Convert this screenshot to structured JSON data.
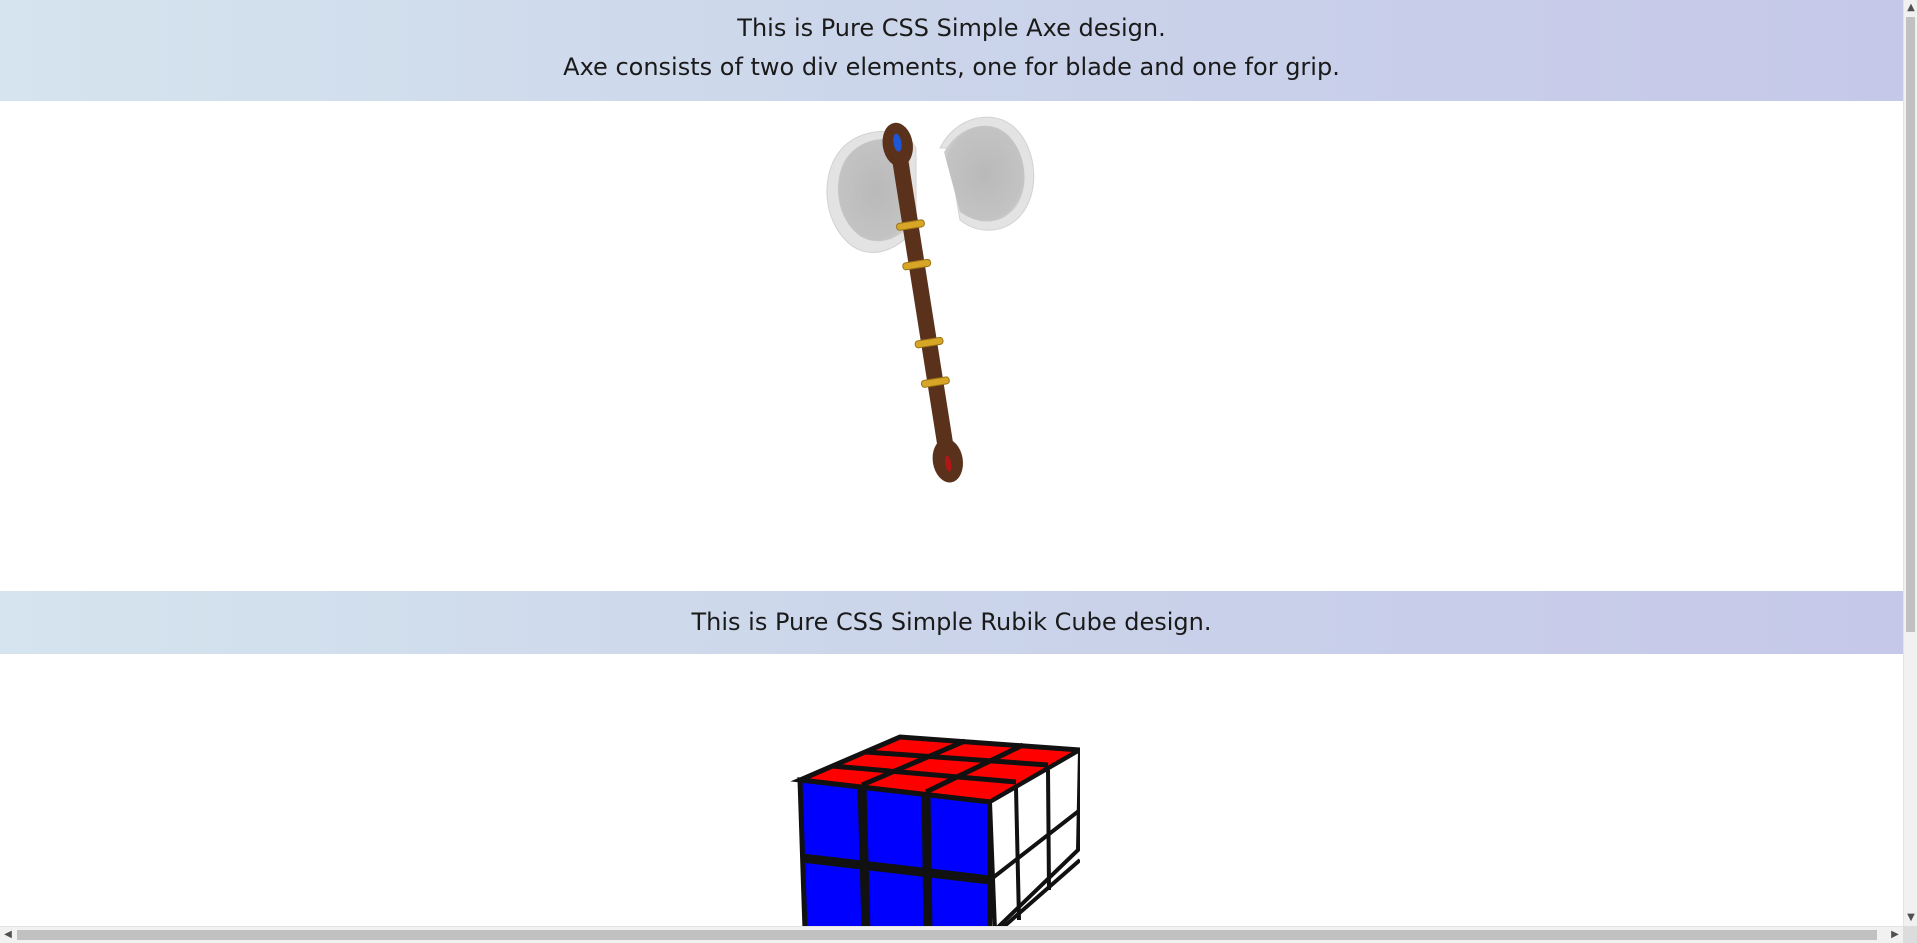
{
  "axe_section": {
    "line1": "This is Pure CSS Simple Axe design.",
    "line2": "Axe consists of two div elements, one for blade and one for grip."
  },
  "cube_section": {
    "line1": "This is Pure CSS Simple Rubik Cube design."
  },
  "colors": {
    "banner_left": "#d5e4ee",
    "banner_right": "#c6c8e9",
    "blade": "#c4c4c4",
    "grip": "#5a321c",
    "grip_bands": "#d8a627",
    "gem_top": "#1f56d6",
    "gem_bottom": "#b01818",
    "cube_top": "#ff0000",
    "cube_front": "#0000ff",
    "cube_side": "#ffffff"
  },
  "scrollbars": {
    "up_arrow": "▲",
    "down_arrow": "▼",
    "left_arrow": "◀",
    "right_arrow": "▶"
  }
}
